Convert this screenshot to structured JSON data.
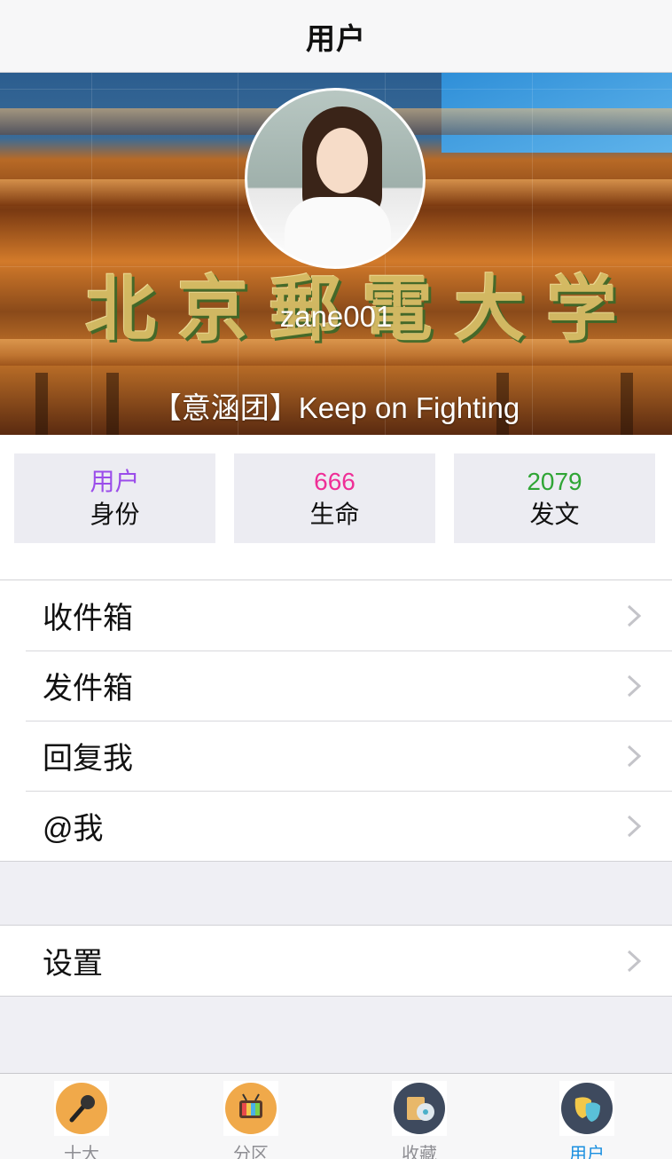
{
  "navbar": {
    "title": "用户"
  },
  "profile": {
    "username": "zane001",
    "signature": "【意涵团】Keep on Fighting",
    "banner_sign": [
      "北",
      "京",
      "郵",
      "電",
      "大",
      "学"
    ]
  },
  "stats": [
    {
      "value": "用户",
      "label": "身份",
      "color": "#9b4dea"
    },
    {
      "value": "666",
      "label": "生命",
      "color": "#ef2f97"
    },
    {
      "value": "2079",
      "label": "发文",
      "color": "#2fa535"
    }
  ],
  "menu": [
    {
      "label": "收件箱"
    },
    {
      "label": "发件箱"
    },
    {
      "label": "回复我"
    },
    {
      "label": "@我"
    }
  ],
  "settings": {
    "label": "设置"
  },
  "tabs": [
    {
      "label": "十大",
      "icon": "microphone-icon",
      "color": "#f0a94a"
    },
    {
      "label": "分区",
      "icon": "tv-icon",
      "color": "#f0a94a"
    },
    {
      "label": "收藏",
      "icon": "collection-icon",
      "color": "#3e4a5e"
    },
    {
      "label": "用户",
      "icon": "drama-mask-icon",
      "color": "#3e4a5e",
      "active": true
    }
  ]
}
